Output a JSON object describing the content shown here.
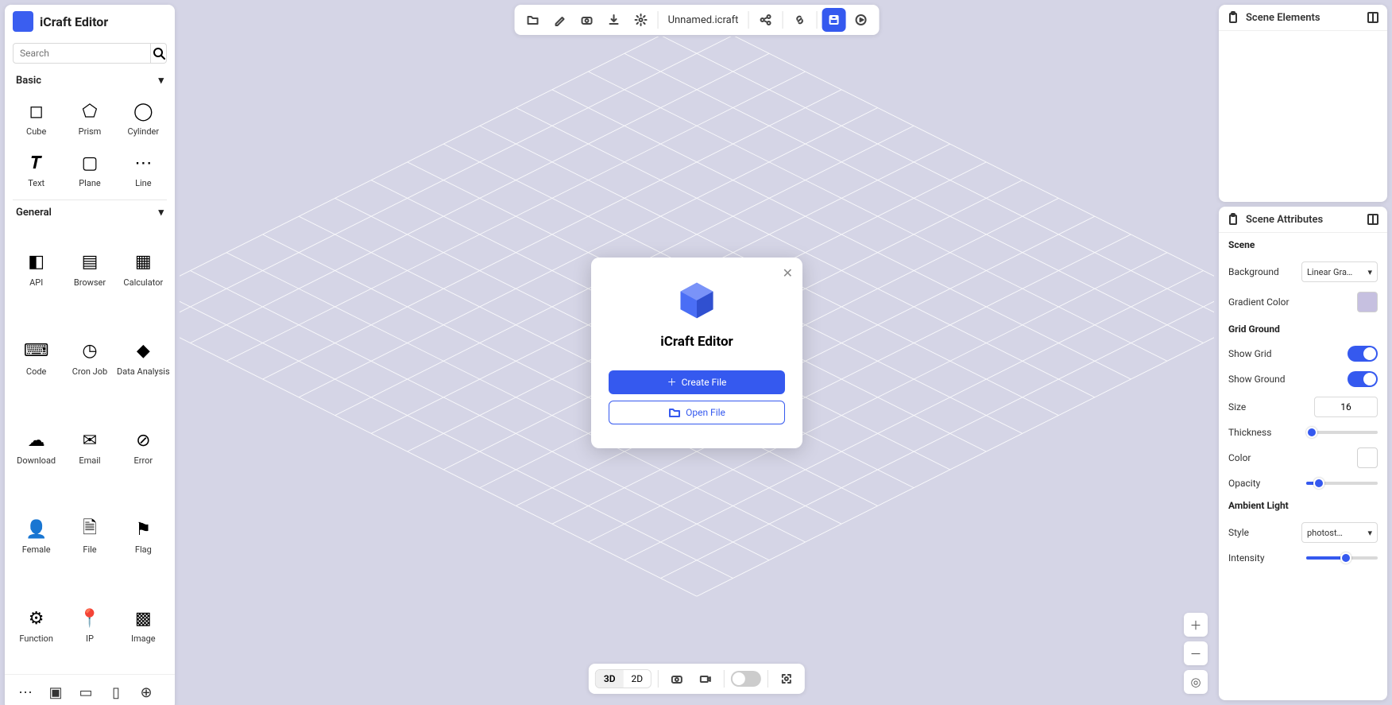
{
  "app": {
    "title": "iCraft Editor",
    "filename": "Unnamed.icraft"
  },
  "search": {
    "placeholder": "Search"
  },
  "sections": {
    "basic": {
      "title": "Basic",
      "items": [
        "Cube",
        "Prism",
        "Cylinder",
        "Text",
        "Plane",
        "Line"
      ]
    },
    "general": {
      "title": "General",
      "items": [
        "API",
        "Browser",
        "Calculator",
        "Code",
        "Cron Job",
        "Data Analysis",
        "Download",
        "Email",
        "Error",
        "Female",
        "File",
        "Flag",
        "Function",
        "IP",
        "Image"
      ]
    }
  },
  "modal": {
    "title": "iCraft Editor",
    "create": "Create File",
    "open": "Open File"
  },
  "right": {
    "elements_title": "Scene Elements",
    "attr_title": "Scene Attributes",
    "scene_label": "Scene",
    "background_label": "Background",
    "background_value": "Linear Gra…",
    "gradient_color_label": "Gradient Color",
    "grid_ground_label": "Grid Ground",
    "show_grid_label": "Show Grid",
    "show_ground_label": "Show Ground",
    "size_label": "Size",
    "size_value": "16",
    "thickness_label": "Thickness",
    "color_label": "Color",
    "opacity_label": "Opacity",
    "ambient_label": "Ambient Light",
    "style_label": "Style",
    "style_value": "photost…",
    "intensity_label": "Intensity"
  },
  "view": {
    "three_d": "3D",
    "two_d": "2D"
  }
}
